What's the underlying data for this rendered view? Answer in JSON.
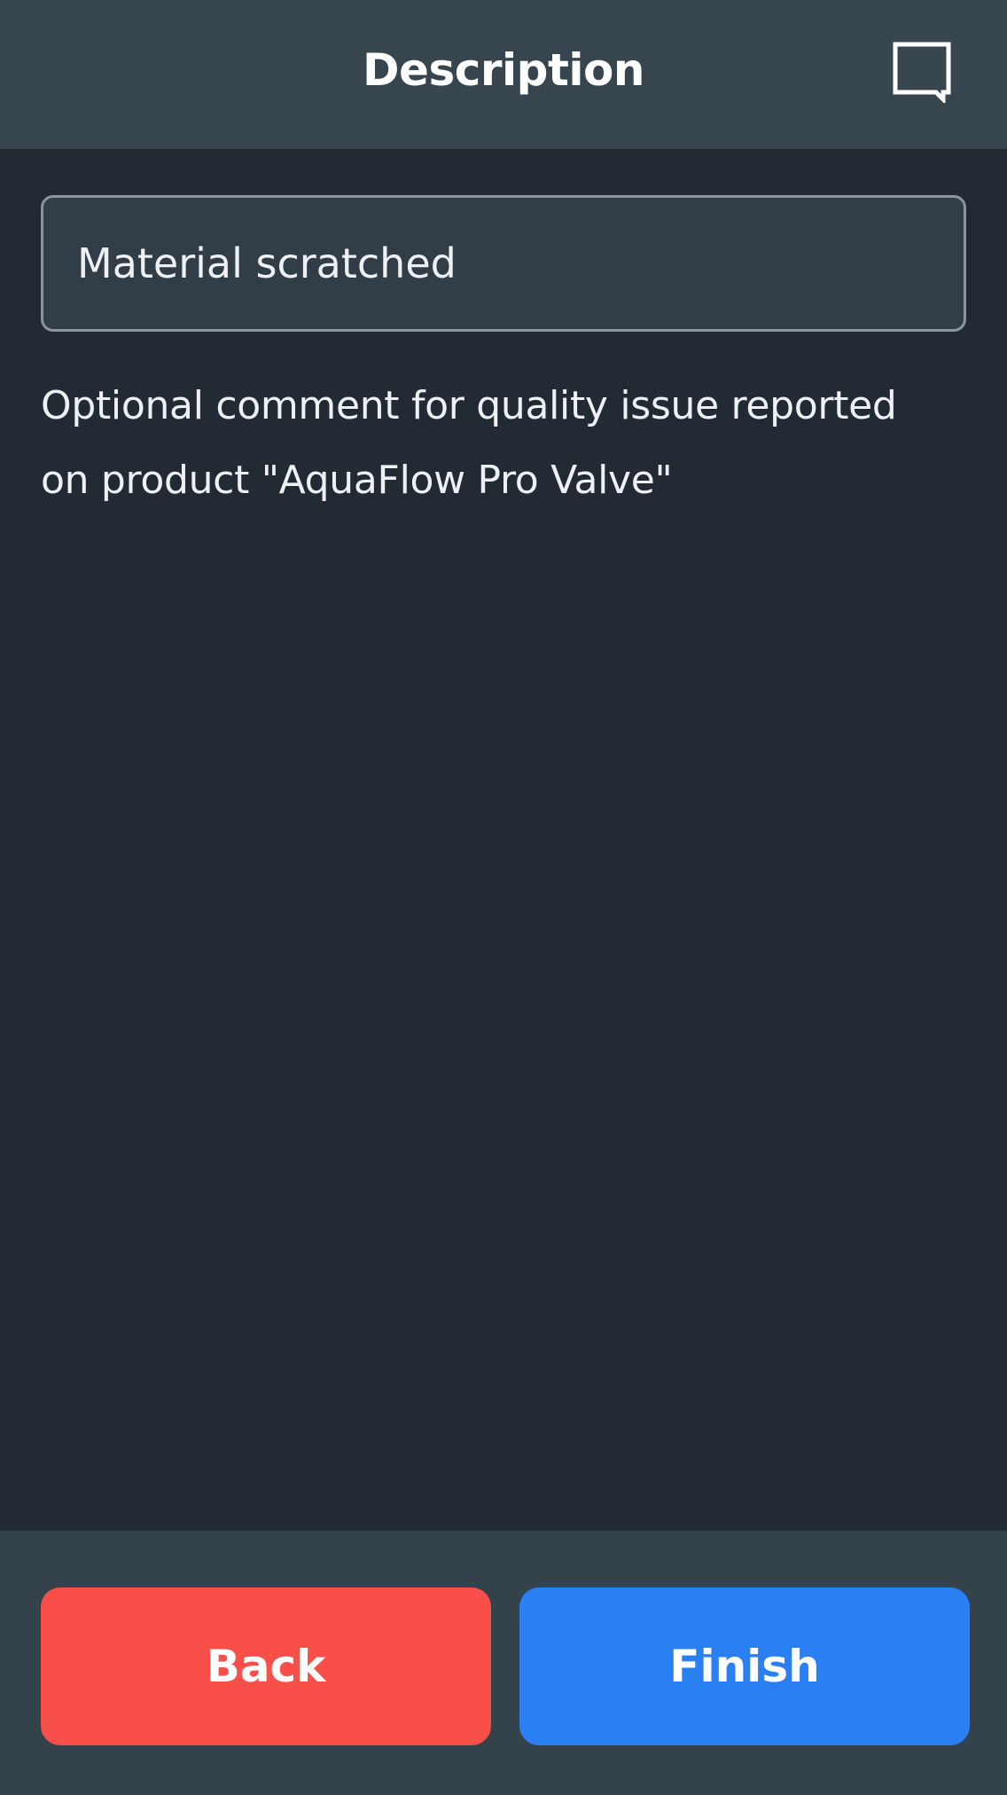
{
  "header": {
    "title": "Description",
    "comment_icon": "comment-icon"
  },
  "form": {
    "description_value": "Material scratched",
    "hint_line1": "Optional comment for quality issue reported",
    "hint_line2": "on product \"AquaFlow Pro Valve\""
  },
  "footer": {
    "back_label": "Back",
    "finish_label": "Finish"
  },
  "colors": {
    "header_bg": "#37454f",
    "content_bg": "#222b34",
    "footer_bg": "#33424b",
    "back_button": "#f84f48",
    "finish_button": "#2a7ff2"
  }
}
